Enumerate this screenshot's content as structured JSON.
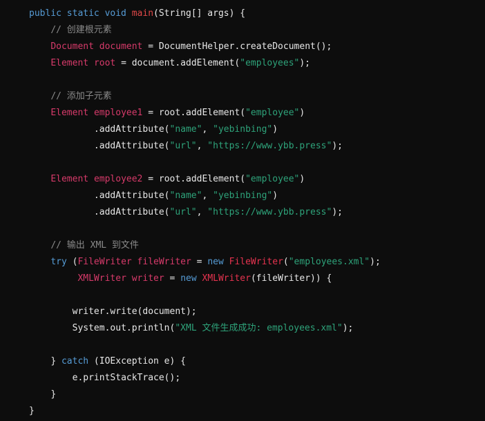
{
  "code_block": {
    "language": "java",
    "lines": [
      {
        "indent": "",
        "tokens": [
          {
            "t": "kw",
            "v": "public static void "
          },
          {
            "t": "fn",
            "v": "main"
          },
          {
            "t": "plain",
            "v": "(String[] args) {"
          }
        ]
      },
      {
        "indent": "    ",
        "tokens": [
          {
            "t": "cmt",
            "v": "// 创建根元素"
          }
        ]
      },
      {
        "indent": "    ",
        "tokens": [
          {
            "t": "type",
            "v": "Document "
          },
          {
            "t": "var",
            "v": "document"
          },
          {
            "t": "plain",
            "v": " = DocumentHelper.createDocument();"
          }
        ]
      },
      {
        "indent": "    ",
        "tokens": [
          {
            "t": "type",
            "v": "Element "
          },
          {
            "t": "var",
            "v": "root"
          },
          {
            "t": "plain",
            "v": " = document.addElement("
          },
          {
            "t": "str",
            "v": "\"employees\""
          },
          {
            "t": "plain",
            "v": ");"
          }
        ]
      },
      {
        "indent": "",
        "tokens": []
      },
      {
        "indent": "    ",
        "tokens": [
          {
            "t": "cmt",
            "v": "// 添加子元素"
          }
        ]
      },
      {
        "indent": "    ",
        "tokens": [
          {
            "t": "type",
            "v": "Element "
          },
          {
            "t": "var",
            "v": "employee1"
          },
          {
            "t": "plain",
            "v": " = root.addElement("
          },
          {
            "t": "str",
            "v": "\"employee\""
          },
          {
            "t": "plain",
            "v": ")"
          }
        ]
      },
      {
        "indent": "            ",
        "tokens": [
          {
            "t": "plain",
            "v": ".addAttribute("
          },
          {
            "t": "str",
            "v": "\"name\""
          },
          {
            "t": "plain",
            "v": ", "
          },
          {
            "t": "str",
            "v": "\"yebinbing\""
          },
          {
            "t": "plain",
            "v": ")"
          }
        ]
      },
      {
        "indent": "            ",
        "tokens": [
          {
            "t": "plain",
            "v": ".addAttribute("
          },
          {
            "t": "str",
            "v": "\"url\""
          },
          {
            "t": "plain",
            "v": ", "
          },
          {
            "t": "str",
            "v": "\"https://www.ybb.press\""
          },
          {
            "t": "plain",
            "v": ");"
          }
        ]
      },
      {
        "indent": "",
        "tokens": []
      },
      {
        "indent": "    ",
        "tokens": [
          {
            "t": "type",
            "v": "Element "
          },
          {
            "t": "var",
            "v": "employee2"
          },
          {
            "t": "plain",
            "v": " = root.addElement("
          },
          {
            "t": "str",
            "v": "\"employee\""
          },
          {
            "t": "plain",
            "v": ")"
          }
        ]
      },
      {
        "indent": "            ",
        "tokens": [
          {
            "t": "plain",
            "v": ".addAttribute("
          },
          {
            "t": "str",
            "v": "\"name\""
          },
          {
            "t": "plain",
            "v": ", "
          },
          {
            "t": "str",
            "v": "\"yebinbing\""
          },
          {
            "t": "plain",
            "v": ")"
          }
        ]
      },
      {
        "indent": "            ",
        "tokens": [
          {
            "t": "plain",
            "v": ".addAttribute("
          },
          {
            "t": "str",
            "v": "\"url\""
          },
          {
            "t": "plain",
            "v": ", "
          },
          {
            "t": "str",
            "v": "\"https://www.ybb.press\""
          },
          {
            "t": "plain",
            "v": ");"
          }
        ]
      },
      {
        "indent": "",
        "tokens": []
      },
      {
        "indent": "    ",
        "tokens": [
          {
            "t": "cmt",
            "v": "// 输出 XML 到文件"
          }
        ]
      },
      {
        "indent": "    ",
        "tokens": [
          {
            "t": "kw",
            "v": "try"
          },
          {
            "t": "plain",
            "v": " ("
          },
          {
            "t": "type",
            "v": "FileWriter "
          },
          {
            "t": "var",
            "v": "fileWriter"
          },
          {
            "t": "plain",
            "v": " = "
          },
          {
            "t": "kw",
            "v": "new "
          },
          {
            "t": "cls",
            "v": "FileWriter"
          },
          {
            "t": "plain",
            "v": "("
          },
          {
            "t": "str",
            "v": "\"employees.xml\""
          },
          {
            "t": "plain",
            "v": ");"
          }
        ]
      },
      {
        "indent": "         ",
        "tokens": [
          {
            "t": "type",
            "v": "XMLWriter "
          },
          {
            "t": "var",
            "v": "writer"
          },
          {
            "t": "plain",
            "v": " = "
          },
          {
            "t": "kw",
            "v": "new "
          },
          {
            "t": "cls",
            "v": "XMLWriter"
          },
          {
            "t": "plain",
            "v": "(fileWriter)) {"
          }
        ]
      },
      {
        "indent": "",
        "tokens": []
      },
      {
        "indent": "        ",
        "tokens": [
          {
            "t": "plain",
            "v": "writer.write(document);"
          }
        ]
      },
      {
        "indent": "        ",
        "tokens": [
          {
            "t": "plain",
            "v": "System.out.println("
          },
          {
            "t": "str",
            "v": "\"XML 文件生成成功: employees.xml\""
          },
          {
            "t": "plain",
            "v": ");"
          }
        ]
      },
      {
        "indent": "",
        "tokens": []
      },
      {
        "indent": "    ",
        "tokens": [
          {
            "t": "plain",
            "v": "} "
          },
          {
            "t": "kw",
            "v": "catch"
          },
          {
            "t": "plain",
            "v": " (IOException e) {"
          }
        ]
      },
      {
        "indent": "        ",
        "tokens": [
          {
            "t": "plain",
            "v": "e.printStackTrace();"
          }
        ]
      },
      {
        "indent": "    ",
        "tokens": [
          {
            "t": "plain",
            "v": "}"
          }
        ]
      },
      {
        "indent": "",
        "tokens": [
          {
            "t": "plain",
            "v": "}"
          }
        ]
      }
    ]
  }
}
